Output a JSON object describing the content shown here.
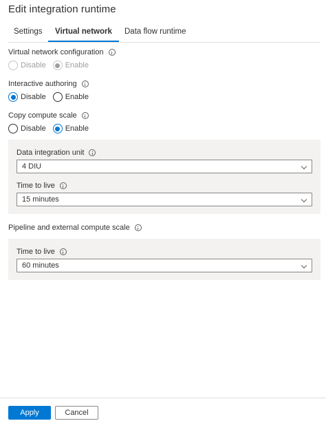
{
  "header": {
    "title": "Edit integration runtime"
  },
  "tabs": [
    {
      "label": "Settings",
      "active": false
    },
    {
      "label": "Virtual network",
      "active": true
    },
    {
      "label": "Data flow runtime",
      "active": false
    }
  ],
  "vnet_config": {
    "label": "Virtual network configuration",
    "options": [
      "Disable",
      "Enable"
    ],
    "selected": "Enable",
    "disabled": true
  },
  "interactive_authoring": {
    "label": "Interactive authoring",
    "options": [
      "Disable",
      "Enable"
    ],
    "selected": "Disable"
  },
  "copy_compute_scale": {
    "label": "Copy compute scale",
    "options": [
      "Disable",
      "Enable"
    ],
    "selected": "Enable",
    "diu": {
      "label": "Data integration unit",
      "value": "4 DIU"
    },
    "ttl": {
      "label": "Time to live",
      "value": "15 minutes"
    }
  },
  "pipeline_scale": {
    "label": "Pipeline and external compute scale",
    "ttl": {
      "label": "Time to live",
      "value": "60 minutes"
    }
  },
  "footer": {
    "apply_label": "Apply",
    "cancel_label": "Cancel"
  },
  "colors": {
    "accent": "#0078d4",
    "panel": "#f3f2f1",
    "border": "#8a8886"
  }
}
